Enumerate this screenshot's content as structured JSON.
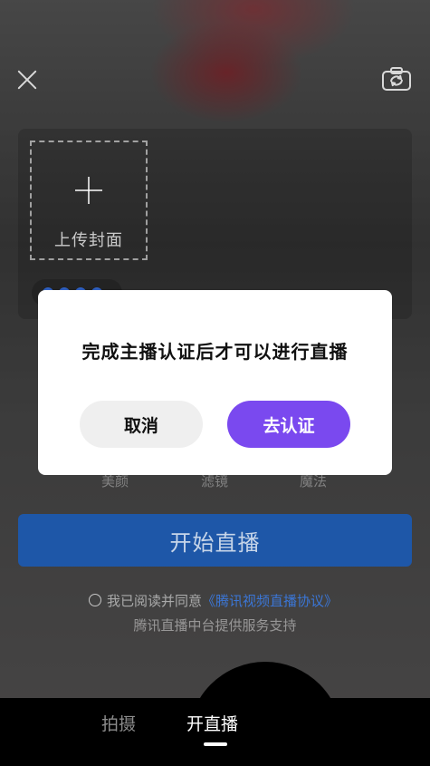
{
  "top": {
    "close_icon": "close-icon",
    "flip_icon": "camera-flip-icon"
  },
  "cover": {
    "upload_label": "上传封面",
    "plus_icon": "plus-icon"
  },
  "effects": {
    "beauty": "美颜",
    "filter": "滤镜",
    "magic": "魔法"
  },
  "actions": {
    "start_live": "开始直播"
  },
  "agreement": {
    "prefix": "我已阅读并同意",
    "link": "《腾讯视频直播协议》",
    "powered_by": "腾讯直播中台提供服务支持"
  },
  "modal": {
    "message": "完成主播认证后才可以进行直播",
    "cancel": "取消",
    "confirm": "去认证"
  },
  "bottom_nav": {
    "shoot": "拍摄",
    "live": "开直播",
    "active": "开直播"
  },
  "colors": {
    "primary_purple": "#7a49ef",
    "start_button_blue": "#1e57a8",
    "link_blue": "#3b76d6"
  }
}
